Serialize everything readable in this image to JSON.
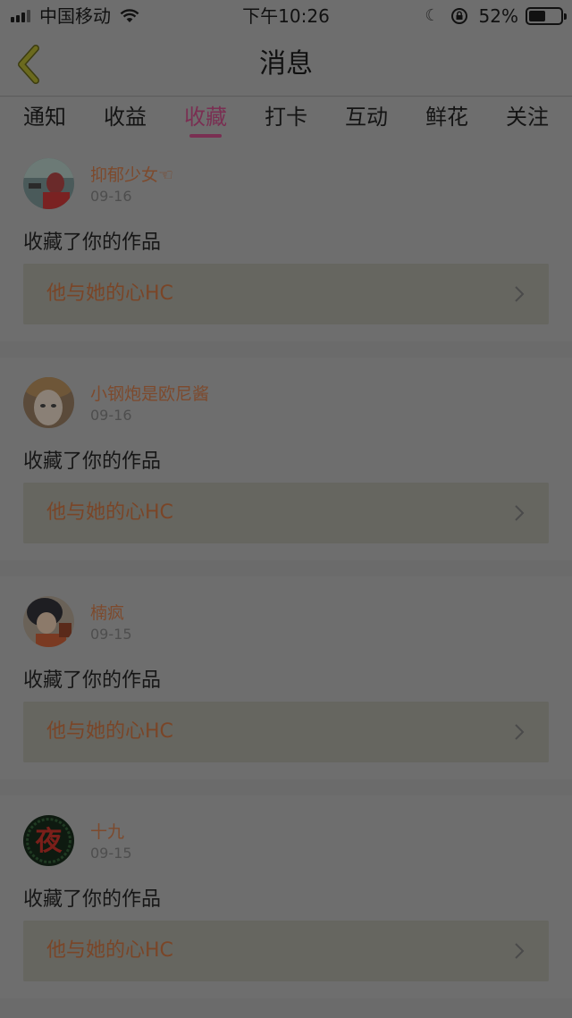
{
  "status_bar": {
    "carrier": "中国移动",
    "time": "下午10:26",
    "battery_percent_text": "52%",
    "battery_level": 0.52,
    "icons": [
      "signal-icon",
      "wifi-icon",
      "moon-icon",
      "orientation-lock-icon",
      "battery-icon"
    ]
  },
  "nav": {
    "title": "消息",
    "back_icon": "chevron-left-icon"
  },
  "tabs": [
    {
      "label": "通知",
      "active": false
    },
    {
      "label": "收益",
      "active": false
    },
    {
      "label": "收藏",
      "active": true
    },
    {
      "label": "打卡",
      "active": false
    },
    {
      "label": "互动",
      "active": false
    },
    {
      "label": "鲜花",
      "active": false
    },
    {
      "label": "关注",
      "active": false
    }
  ],
  "notifications": [
    {
      "user": "抑郁少女☜",
      "date": "09-16",
      "action": "收藏了你的作品",
      "work_title": "他与她的心HC"
    },
    {
      "user": "小钢炮是欧尼酱",
      "date": "09-16",
      "action": "收藏了你的作品",
      "work_title": "他与她的心HC"
    },
    {
      "user": "楠疯",
      "date": "09-15",
      "action": "收藏了你的作品",
      "work_title": "他与她的心HC"
    },
    {
      "user": "十九",
      "date": "09-15",
      "action": "收藏了你的作品",
      "work_title": "他与她的心HC"
    }
  ],
  "colors": {
    "accent_active_tab": "#7a2f52",
    "username": "#7d4a2d",
    "work_title": "#7a4527",
    "back_arrow": "#6b6a1e"
  }
}
